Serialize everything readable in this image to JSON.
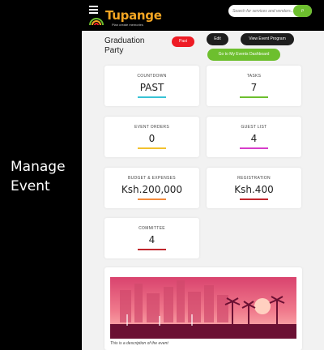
{
  "caption": {
    "line1": "Manage",
    "line2": "Event"
  },
  "header": {
    "logo_text": "Tupange",
    "logo_tagline": "Plan create memories",
    "search_placeholder": "Search for services and vendors...",
    "search_button": "ρ"
  },
  "event": {
    "title_line1": "Graduation",
    "title_line2": "Party",
    "status": "Past",
    "edit_label": "Edit",
    "program_label": "View Event Program",
    "dashboard_label": "Go to My Events Dashboard"
  },
  "cards": [
    {
      "label": "COUNTDOWN",
      "value": "PAST",
      "color": "#38c3d6"
    },
    {
      "label": "TASKS",
      "value": "7",
      "color": "#6dbf2e"
    },
    {
      "label": "EVENT ORDERS",
      "value": "0",
      "color": "#f2c12e"
    },
    {
      "label": "GUEST LIST",
      "value": "4",
      "color": "#d63cc9"
    },
    {
      "label": "BUDGET & EXPENSES",
      "value": "Ksh.200,000",
      "color": "#f28a3c"
    },
    {
      "label": "REGISTRATION",
      "value": "Ksh.400",
      "color": "#c1272d"
    },
    {
      "label": "COMMITTEE",
      "value": "4",
      "color": "#c1272d"
    }
  ],
  "image": {
    "description": "This is a description of the event"
  },
  "colors": {
    "accent_green": "#6dbf2e",
    "status_red": "#ee1c25",
    "brand_orange": "#f5a623"
  }
}
